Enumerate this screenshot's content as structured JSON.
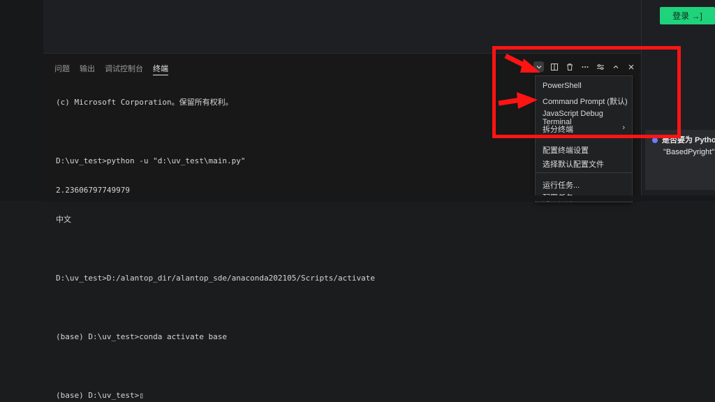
{
  "right_panel": {
    "login_label": "登录 →]"
  },
  "panel": {
    "tabs": [
      {
        "label": "问题"
      },
      {
        "label": "输出"
      },
      {
        "label": "调试控制台"
      },
      {
        "label": "终端"
      }
    ],
    "terminal_lines": [
      "(c) Microsoft Corporation。保留所有权利。",
      "",
      "D:\\uv_test>python -u \"d:\\uv_test\\main.py\"",
      "2.23606797749979",
      "中文",
      "",
      "D:\\uv_test>D:/alantop_dir/alantop_sde/anaconda202105/Scripts/activate",
      "",
      "(base) D:\\uv_test>conda activate base",
      "",
      "(base) D:\\uv_test>▯"
    ]
  },
  "toolbar": {
    "icons": [
      "chevron-down-icon",
      "split-icon",
      "trash-icon",
      "more-icon",
      "settings-sliders-icon",
      "chevron-up-icon",
      "close-icon"
    ]
  },
  "menu": {
    "items": [
      {
        "label": "PowerShell"
      },
      {
        "label": "Command Prompt (默认)"
      },
      {
        "label": "JavaScript Debug Terminal"
      },
      {
        "label": "拆分终端",
        "submenu": true
      },
      {
        "label": "配置终端设置"
      },
      {
        "label": "选择默认配置文件"
      },
      {
        "label": "运行任务..."
      },
      {
        "label": "配置任务"
      }
    ]
  },
  "toast": {
    "line1": "是否要为 Pytho",
    "line2": "\"BasedPyright\""
  },
  "colors": {
    "accent_green": "#1fd37c",
    "annotation_red": "#ff1414"
  }
}
